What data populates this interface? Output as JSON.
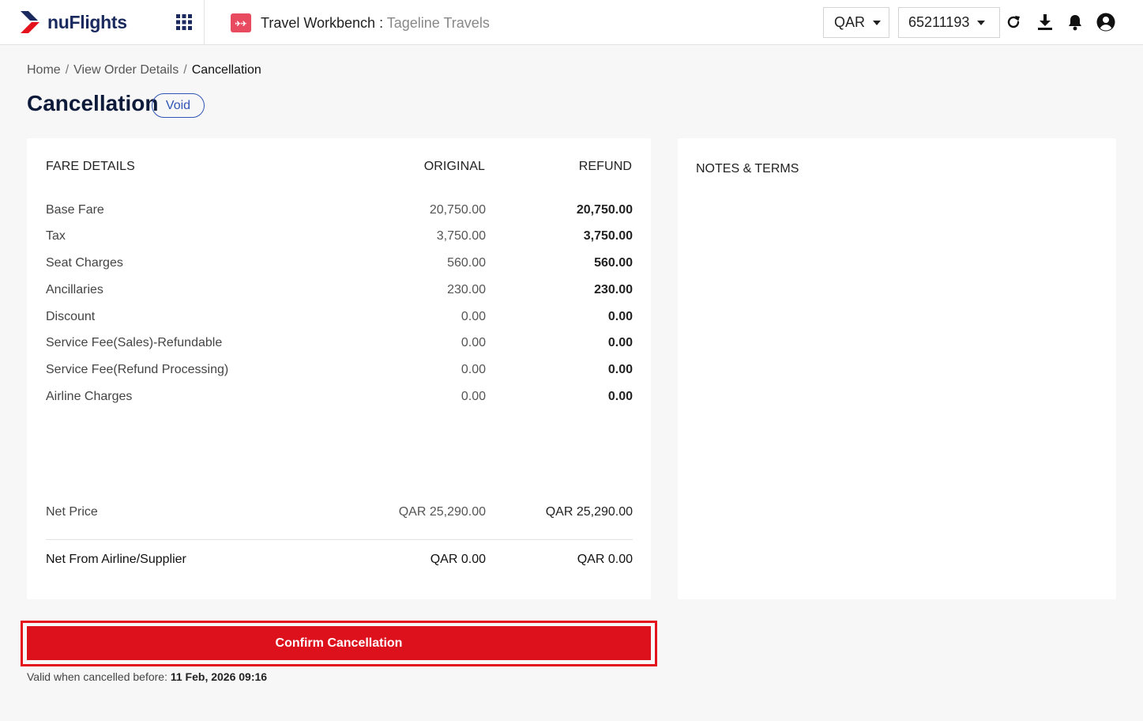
{
  "brand": {
    "name": "nuFlights",
    "accent": "#e3121d",
    "navy": "#1a2a5e"
  },
  "header": {
    "workbench_title": "Travel Workbench",
    "workbench_sep": " : ",
    "agency_name": "Tageline Travels",
    "currency": "QAR",
    "account": "65211193",
    "icons": [
      "apps-grid-icon",
      "ticket-icon",
      "refresh-icon",
      "download-icon",
      "bell-icon",
      "user-circle-icon"
    ]
  },
  "breadcrumb": [
    {
      "label": "Home"
    },
    {
      "label": "View Order Details"
    },
    {
      "label": "Cancellation"
    }
  ],
  "page": {
    "title": "Cancellation",
    "badge": "Void"
  },
  "fare": {
    "headers": {
      "label": "FARE DETAILS",
      "original": "ORIGINAL",
      "refund": "REFUND"
    },
    "rows": [
      {
        "label": "Base Fare",
        "original": "20,750.00",
        "refund": "20,750.00"
      },
      {
        "label": "Tax",
        "original": "3,750.00",
        "refund": "3,750.00"
      },
      {
        "label": "Seat Charges",
        "original": "560.00",
        "refund": "560.00"
      },
      {
        "label": "Ancillaries",
        "original": "230.00",
        "refund": "230.00"
      },
      {
        "label": "Discount",
        "original": "0.00",
        "refund": "0.00"
      },
      {
        "label": "Service Fee(Sales)-Refundable",
        "original": "0.00",
        "refund": "0.00"
      },
      {
        "label": "Service Fee(Refund Processing)",
        "original": "0.00",
        "refund": "0.00"
      },
      {
        "label": "Airline Charges",
        "original": "0.00",
        "refund": "0.00"
      }
    ],
    "net_price": {
      "label": "Net Price",
      "original": "QAR 25,290.00",
      "refund": "QAR 25,290.00"
    },
    "net_supplier": {
      "label": "Net From Airline/Supplier",
      "original": "QAR 0.00",
      "refund": "QAR 0.00"
    }
  },
  "notes": {
    "title": "NOTES & TERMS"
  },
  "actions": {
    "confirm_label": "Confirm Cancellation"
  },
  "validity": {
    "prefix": "Valid when cancelled before: ",
    "date": "11 Feb, 2026 09:16"
  }
}
